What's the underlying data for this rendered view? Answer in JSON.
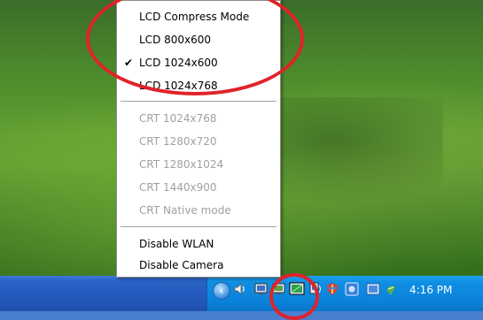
{
  "menu": {
    "items": [
      {
        "label": "LCD Compress Mode",
        "checked": false,
        "enabled": true
      },
      {
        "label": "LCD 800x600",
        "checked": false,
        "enabled": true
      },
      {
        "label": "LCD 1024x600",
        "checked": true,
        "enabled": true
      },
      {
        "label": "LCD 1024x768",
        "checked": false,
        "enabled": true
      },
      {
        "label": "CRT 1024x768",
        "checked": false,
        "enabled": false
      },
      {
        "label": "CRT 1280x720",
        "checked": false,
        "enabled": false
      },
      {
        "label": "CRT 1280x1024",
        "checked": false,
        "enabled": false
      },
      {
        "label": "CRT 1440x900",
        "checked": false,
        "enabled": false
      },
      {
        "label": "CRT Native mode",
        "checked": false,
        "enabled": false
      },
      {
        "label": "Disable WLAN",
        "checked": false,
        "enabled": true
      },
      {
        "label": "Disable Camera",
        "checked": false,
        "enabled": true
      }
    ],
    "check_glyph": "✔"
  },
  "taskbar": {
    "chevron_glyph": "‹",
    "clock": "4:16 PM",
    "tray_icons": [
      "speaker-icon",
      "monitor-icon",
      "monitor-icon",
      "display-settings-icon",
      "network-icon",
      "security-shield-icon",
      "application-icon",
      "application-icon",
      "bluetooth-icon"
    ]
  },
  "colors": {
    "annotation_red": "#e0232a",
    "disabled_text": "#a0a0a0",
    "taskbar_blue": "#2459bd",
    "tray_blue": "#0b83db"
  }
}
